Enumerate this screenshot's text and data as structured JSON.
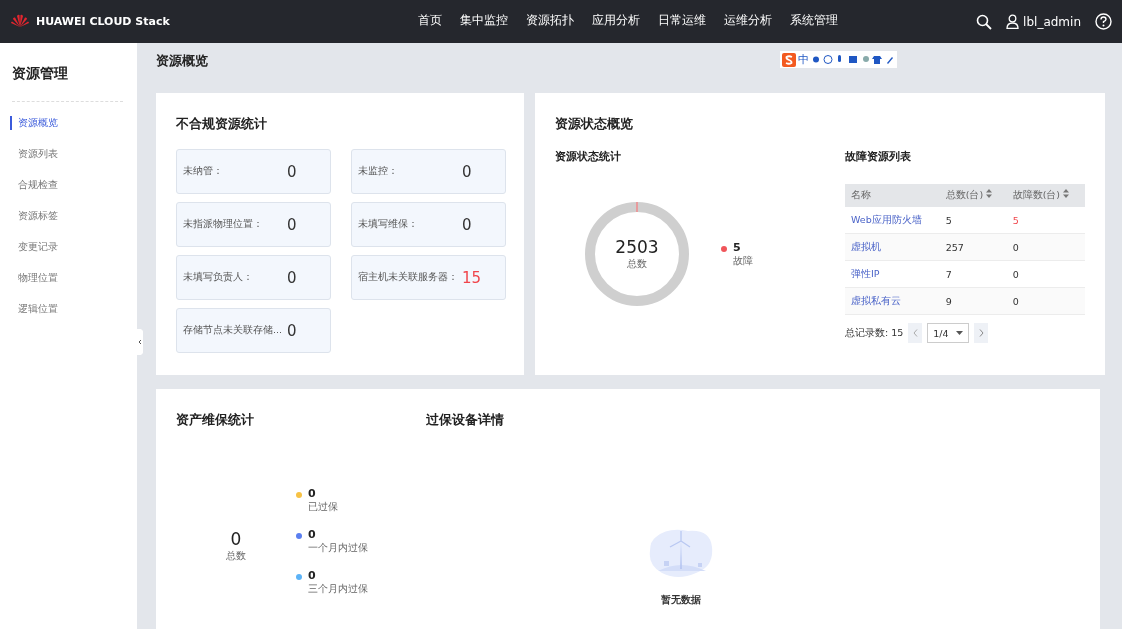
{
  "topbar": {
    "brand": "HUAWEI CLOUD Stack",
    "nav": [
      {
        "label": "首页",
        "selected": false
      },
      {
        "label": "集中监控",
        "selected": false
      },
      {
        "label": "资源拓扑",
        "selected": false
      },
      {
        "label": "应用分析",
        "selected": false
      },
      {
        "label": "日常运维",
        "selected": false
      },
      {
        "label": "运维分析",
        "selected": false
      },
      {
        "label": "系统管理",
        "selected": false
      }
    ],
    "user": "lbl_admin"
  },
  "ime_toolbar": {
    "label": "中"
  },
  "sidebar": {
    "title": "资源管理",
    "items": [
      {
        "label": "资源概览",
        "selected": true
      },
      {
        "label": "资源列表",
        "selected": false
      },
      {
        "label": "合规检查",
        "selected": false
      },
      {
        "label": "资源标签",
        "selected": false
      },
      {
        "label": "变更记录",
        "selected": false
      },
      {
        "label": "物理位置",
        "selected": false
      },
      {
        "label": "逻辑位置",
        "selected": false
      }
    ]
  },
  "page_title": "资源概览",
  "noncompliance": {
    "title": "不合规资源统计",
    "stats": [
      {
        "label": "未纳管：",
        "value": "0",
        "alert": false
      },
      {
        "label": "未监控：",
        "value": "0",
        "alert": false
      },
      {
        "label": "未指派物理位置：",
        "value": "0",
        "alert": false
      },
      {
        "label": "未填写维保：",
        "value": "0",
        "alert": false
      },
      {
        "label": "未填写负责人：",
        "value": "0",
        "alert": false
      },
      {
        "label": "宿主机未关联服务器：",
        "value": "15",
        "alert": true
      },
      {
        "label": "存储节点未关联存储...",
        "value": "0",
        "alert": false
      }
    ]
  },
  "status": {
    "title": "资源状态概览",
    "stats_title": "资源状态统计",
    "total": "2503",
    "total_label": "总数",
    "legend": [
      {
        "value": "5",
        "label": "故障",
        "color": "#f0555a"
      }
    ],
    "fault_table": {
      "title": "故障资源列表",
      "columns": [
        "名称",
        "总数(台)",
        "故障数(台)"
      ],
      "rows": [
        {
          "name": "Web应用防火墙",
          "total": "5",
          "faults": "5",
          "alert": true
        },
        {
          "name": "虚拟机",
          "total": "257",
          "faults": "0",
          "alert": false
        },
        {
          "name": "弹性IP",
          "total": "7",
          "faults": "0",
          "alert": false
        },
        {
          "name": "虚拟私有云",
          "total": "9",
          "faults": "0",
          "alert": false
        }
      ],
      "total_label": "总记录数: 15",
      "page": "1/4"
    }
  },
  "warranty": {
    "title": "资产维保统计",
    "total": "0",
    "total_label": "总数",
    "legend": [
      {
        "value": "0",
        "label": "已过保",
        "color": "#f7c244"
      },
      {
        "value": "0",
        "label": "一个月内过保",
        "color": "#5b7ff0"
      },
      {
        "value": "0",
        "label": "三个月内过保",
        "color": "#5cb3f7"
      }
    ],
    "detail_title": "过保设备详情",
    "empty_text": "暂无数据"
  }
}
